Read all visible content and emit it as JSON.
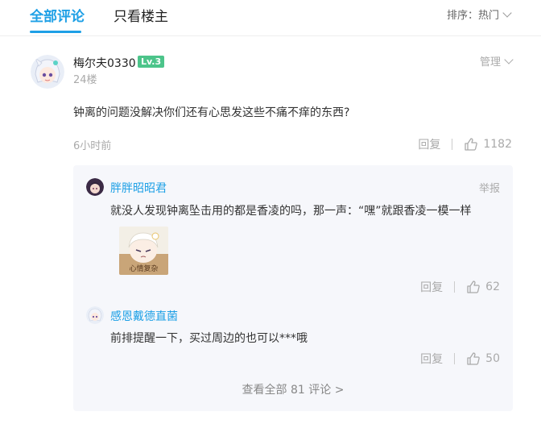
{
  "tabs": [
    {
      "label": "全部评论",
      "active": true
    },
    {
      "label": "只看楼主",
      "active": false
    }
  ],
  "sort": {
    "label": "排序：热门"
  },
  "comment": {
    "username": "梅尔夫0330",
    "level": "Lv.3",
    "floor": "24楼",
    "manage_label": "管理",
    "content": "钟离的问题没解决你们还有心思发这些不痛不痒的东西?",
    "time": "6小时前",
    "reply_label": "回复",
    "likes": "1182"
  },
  "replies": [
    {
      "username": "胖胖昭昭君",
      "report_label": "举报",
      "content": "就没人发现钟离坠击用的都是香凌的吗，那一声：“嘿”就跟香凌一模一样",
      "sticker_text": "心情复杂",
      "reply_label": "回复",
      "likes": "62"
    },
    {
      "username": "感恩戴德直菌",
      "content": "前排提醒一下，买过周边的也可以***哦",
      "reply_label": "回复",
      "likes": "50"
    }
  ],
  "view_all": "查看全部 81 评论 >",
  "colors": {
    "accent": "#1ea0e6",
    "badge": "#4cc48a",
    "reply_bg": "#f6f7fb"
  }
}
